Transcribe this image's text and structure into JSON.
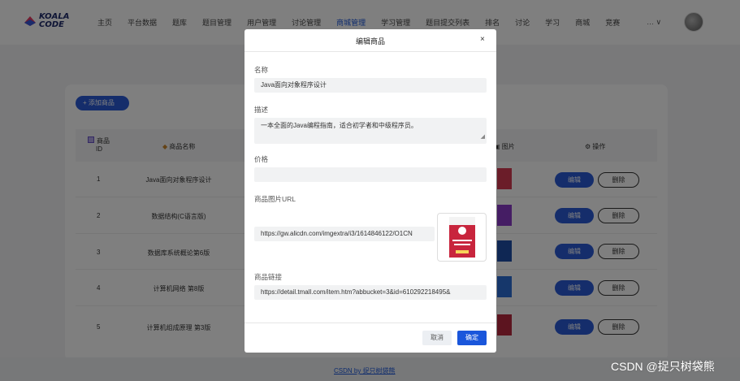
{
  "brand": {
    "logo_line1": "KOALA",
    "logo_line2": "CODE"
  },
  "nav": {
    "items": [
      "主页",
      "平台数据",
      "题库",
      "题目管理",
      "用户管理",
      "讨论管理",
      "商城管理",
      "学习管理",
      "题目提交列表",
      "排名",
      "讨论",
      "学习",
      "商城",
      "竞赛"
    ],
    "active_index": 6,
    "more_label": "… ∨"
  },
  "page": {
    "add_button": "+ 添加商品",
    "columns": {
      "id_line1": "商品",
      "id_line2": "ID",
      "name": "商品名称",
      "image": "图片",
      "actions": "操作"
    },
    "rows": [
      {
        "id": "1",
        "name": "Java面向对象程序设计"
      },
      {
        "id": "2",
        "name": "数据结构(C语言版)"
      },
      {
        "id": "3",
        "name": "数据库系统概论第6版"
      },
      {
        "id": "4",
        "name": "计算机网络 第8版"
      },
      {
        "id": "5",
        "name": "计算机组成原理 第3版"
      }
    ],
    "edit_label": "编辑",
    "delete_label": "删除"
  },
  "dialog": {
    "title": "编辑商品",
    "close": "×",
    "name_label": "名称",
    "name_value": "Java面向对象程序设计",
    "desc_label": "描述",
    "desc_value": "一本全面的Java编程指南，适合初学者和中级程序员。",
    "price_label": "价格",
    "price_value": "",
    "image_label": "商品图片URL",
    "image_value": "https://gw.alicdn.com/imgextra/i3/1614846122/O1CN",
    "link_label": "商品链接",
    "link_value": "https://detail.tmall.com/item.htm?abbucket=3&id=610292218495&",
    "cancel": "取消",
    "confirm": "确定"
  },
  "footer": {
    "link": "CSDN by 捉只树袋熊",
    "watermark": "CSDN @捉只树袋熊"
  },
  "colors": {
    "primary": "#1a56db",
    "overlay": "rgba(0,0,0,0.5)"
  }
}
